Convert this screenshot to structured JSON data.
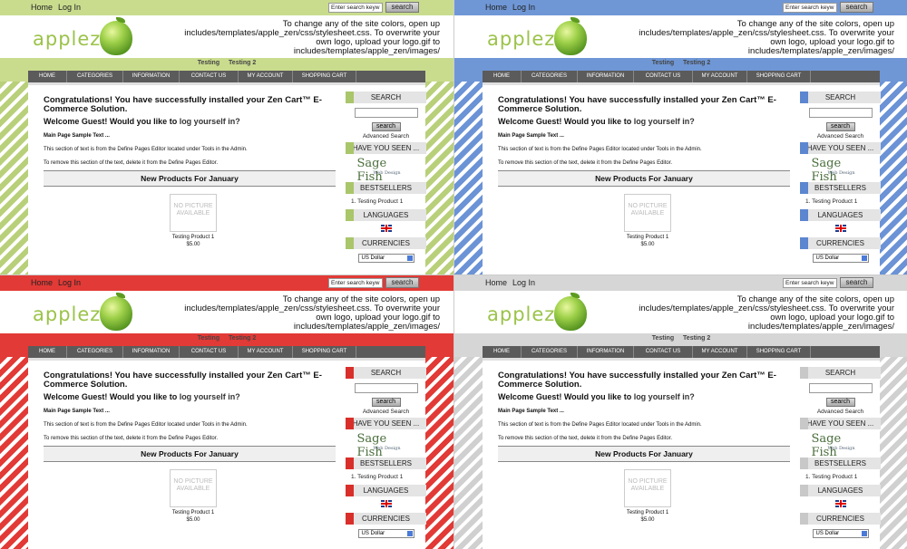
{
  "top": {
    "home": "Home",
    "login": "Log In",
    "search_placeholder": "Enter search keyw",
    "search_button": "search"
  },
  "header": {
    "logo_text": "applezen",
    "instructions": "To change any of the site colors, open up includes/templates/apple_zen/css/stylesheet.css. To overwrite your own logo, upload your logo.gif to includes/templates/apple_zen/images/"
  },
  "subnav": [
    "Testing",
    "Testing 2"
  ],
  "nav": [
    "HOME",
    "CATEGORIES",
    "INFORMATION",
    "CONTACT US",
    "MY ACCOUNT",
    "SHOPPING CART"
  ],
  "main": {
    "congrats": "Congratulations! You have successfully installed your Zen Cart™ E-Commerce Solution.",
    "welcome": "Welcome Guest! Would you like to ",
    "welcome_link": "log yourself in?",
    "sample_title": "Main Page Sample Text ...",
    "section1": "This section of text is from the Define Pages Editor located under Tools in the Admin.",
    "section2": "To remove this section of the text, delete it from the Define Pages Editor.",
    "new_products": "New Products For January",
    "no_picture": "NO PICTURE AVAILABLE",
    "product_name": "Testing Product 1",
    "product_price": "$5.00"
  },
  "sidebar": {
    "search": "SEARCH",
    "search_button": "search",
    "advanced": "Advanced Search",
    "have_you_seen": "HAVE YOU SEEN ...",
    "sage_fish": "Sage Fish",
    "sage_sub": "Web Design",
    "bestsellers": "BESTSELLERS",
    "bestseller_item": "1.  Testing Product 1",
    "languages": "LANGUAGES",
    "currencies": "CURRENCIES",
    "currency_value": "US Dollar"
  },
  "themes": [
    {
      "name": "green",
      "accent": "#c9dc8e",
      "stripe": "#b9d07a",
      "marker": "#a9c66a"
    },
    {
      "name": "blue",
      "accent": "#6f97d6",
      "stripe": "#6b93d6",
      "marker": "#5c86cf"
    },
    {
      "name": "red",
      "accent": "#e23a36",
      "stripe": "#e23a36",
      "marker": "#d92f2b"
    },
    {
      "name": "grey",
      "accent": "#d6d6d6",
      "stripe": "#d0d0d0",
      "marker": "#c8c8c8"
    }
  ]
}
